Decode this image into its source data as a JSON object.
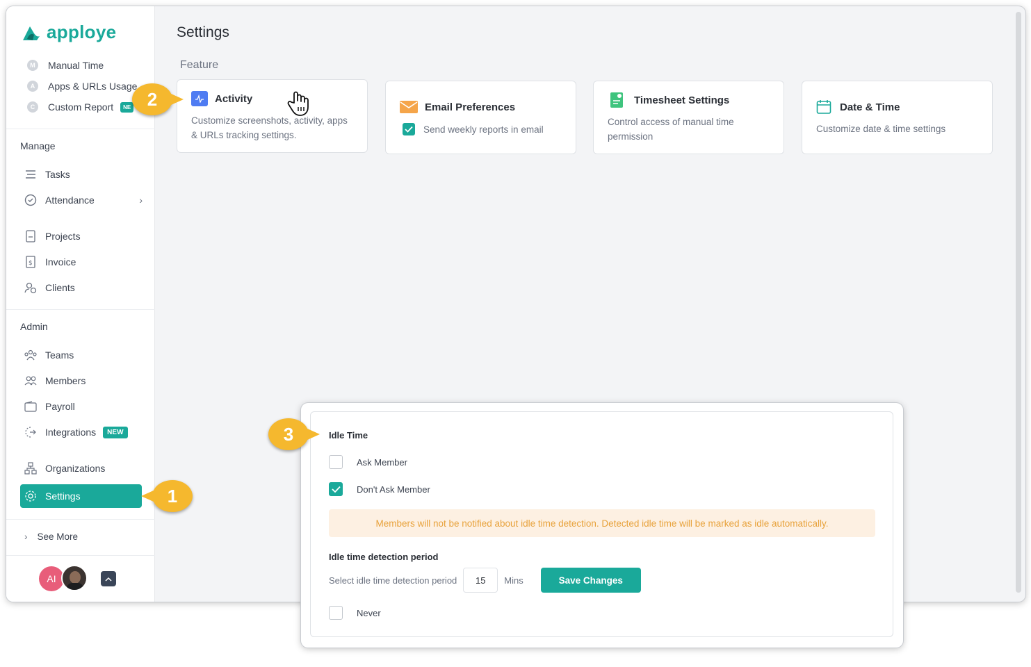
{
  "app": {
    "logo_text": "apploye"
  },
  "sidebar": {
    "report_items": [
      {
        "initial": "M",
        "label": "Manual Time"
      },
      {
        "initial": "A",
        "label": "Apps & URLs Usage"
      },
      {
        "initial": "C",
        "label": "Custom Report",
        "badge": "NE"
      }
    ],
    "manage_title": "Manage",
    "manage_items": [
      "Tasks",
      "Attendance",
      "Projects",
      "Invoice",
      "Clients"
    ],
    "admin_title": "Admin",
    "admin_items": [
      "Teams",
      "Members",
      "Payroll",
      "Integrations",
      "Organizations",
      "Settings"
    ],
    "integrations_badge": "NEW",
    "see_more": "See More",
    "avatar_initials": "AI"
  },
  "main": {
    "title": "Settings",
    "section": "Feature",
    "cards": [
      {
        "title": "Activity",
        "desc": "Customize screenshots, activity, apps & URLs tracking settings."
      },
      {
        "title": "Email Preferences",
        "desc": "Send weekly reports in email"
      },
      {
        "title": "Timesheet Settings",
        "desc": "Control access of manual time permission"
      },
      {
        "title": "Date & Time",
        "desc": "Customize date & time settings"
      }
    ]
  },
  "popup": {
    "idle_title": "Idle Time",
    "ask": "Ask Member",
    "dont_ask": "Don't Ask Member",
    "notice": "Members will not be notified about idle time detection. Detected idle time will be marked as idle automatically.",
    "period_title": "Idle time detection period",
    "period_label": "Select idle time detection period",
    "period_value": "15",
    "period_unit": "Mins",
    "save": "Save Changes",
    "never": "Never"
  },
  "callouts": {
    "one": "1",
    "two": "2",
    "three": "3"
  },
  "colors": {
    "accent": "#1aa99a",
    "callout": "#f5b82e",
    "notice_text": "#e8a23b"
  }
}
